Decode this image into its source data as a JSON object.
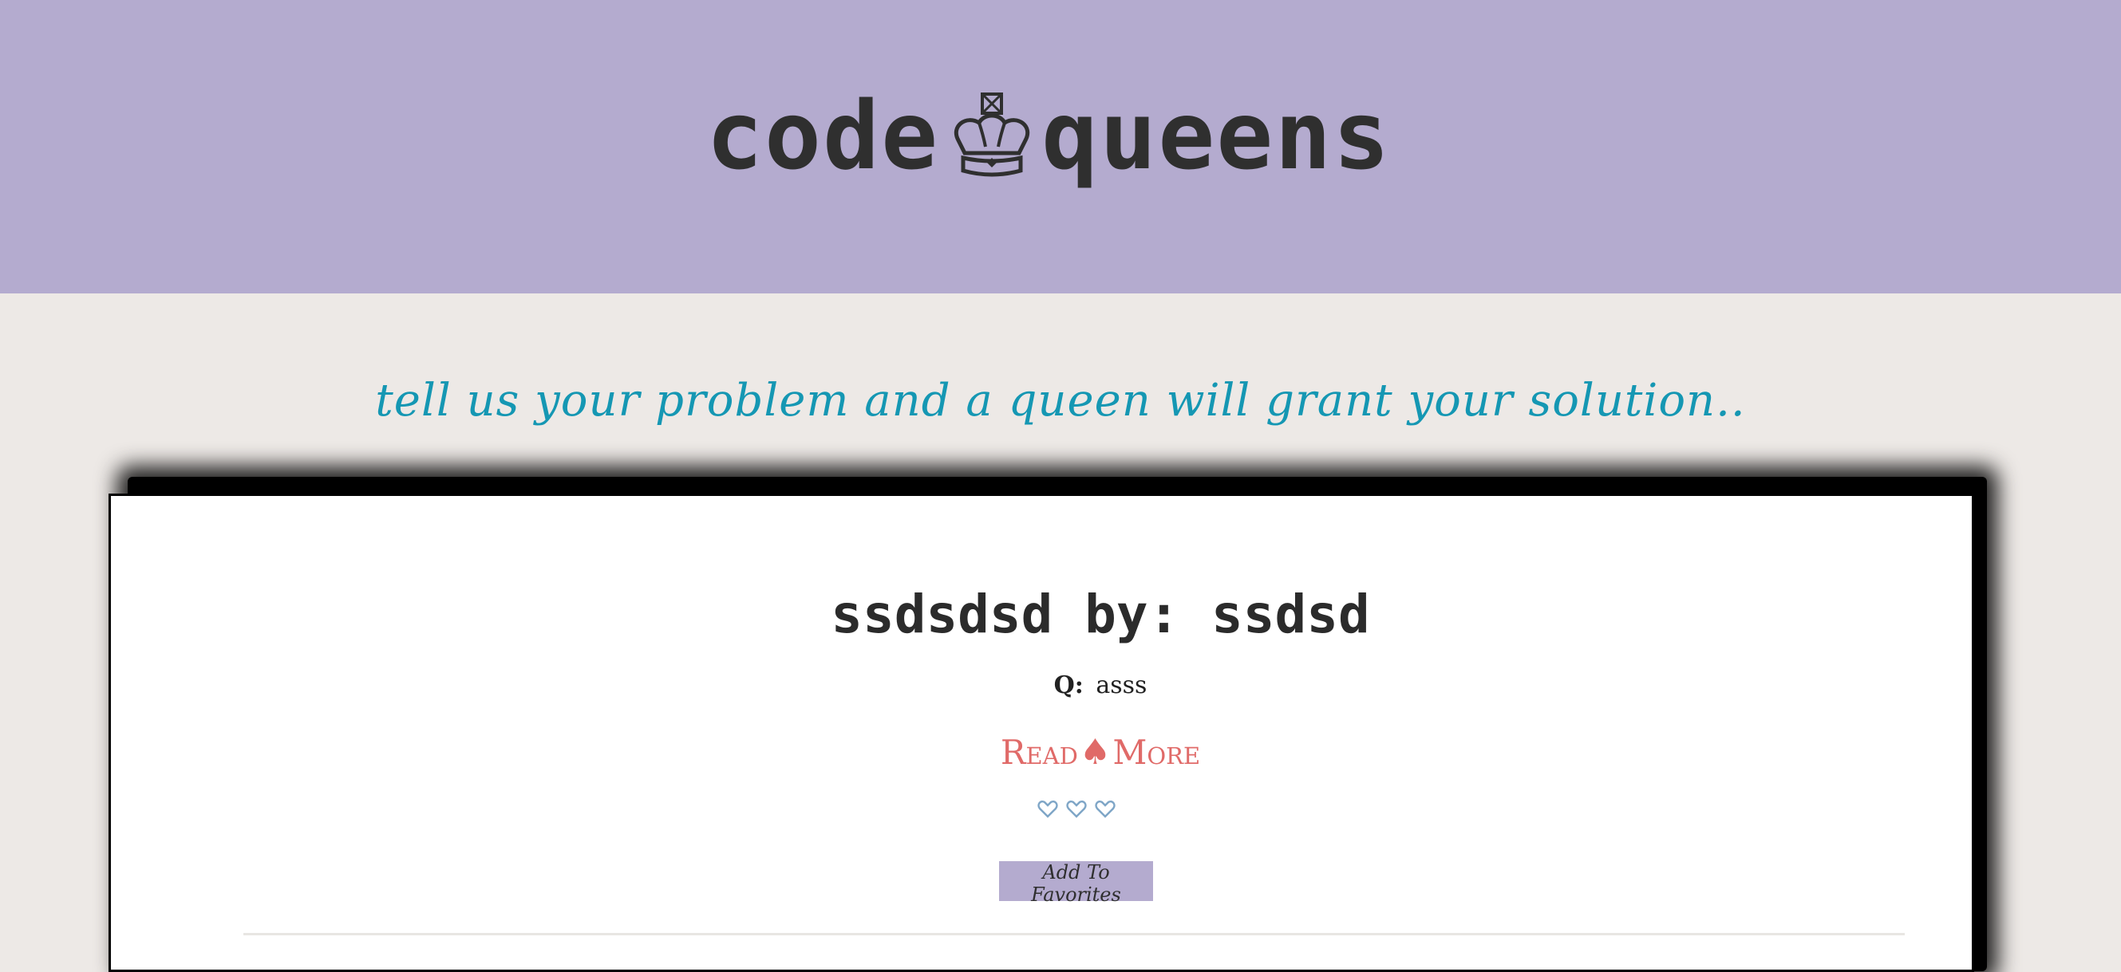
{
  "header": {
    "logo_left": "code",
    "logo_right": "queens",
    "logo_icon": "crown-icon",
    "background": "#b4abcf"
  },
  "tagline": "tell us your problem and a queen will grant your solution..",
  "post": {
    "title": "ssdsdsd by: ssdsd",
    "question_label": "Q:",
    "question_text": "asss",
    "read_more_left": "Read",
    "read_more_icon": "spade-icon",
    "read_more_right": "More",
    "hearts_icon": "heart-outline-icon",
    "add_to_favorites": "Add To Favorites"
  },
  "colors": {
    "page_background": "#ede9e6",
    "accent_teal": "#1597b3",
    "read_more": "#e06a68",
    "heart": "#7fa6c7"
  }
}
